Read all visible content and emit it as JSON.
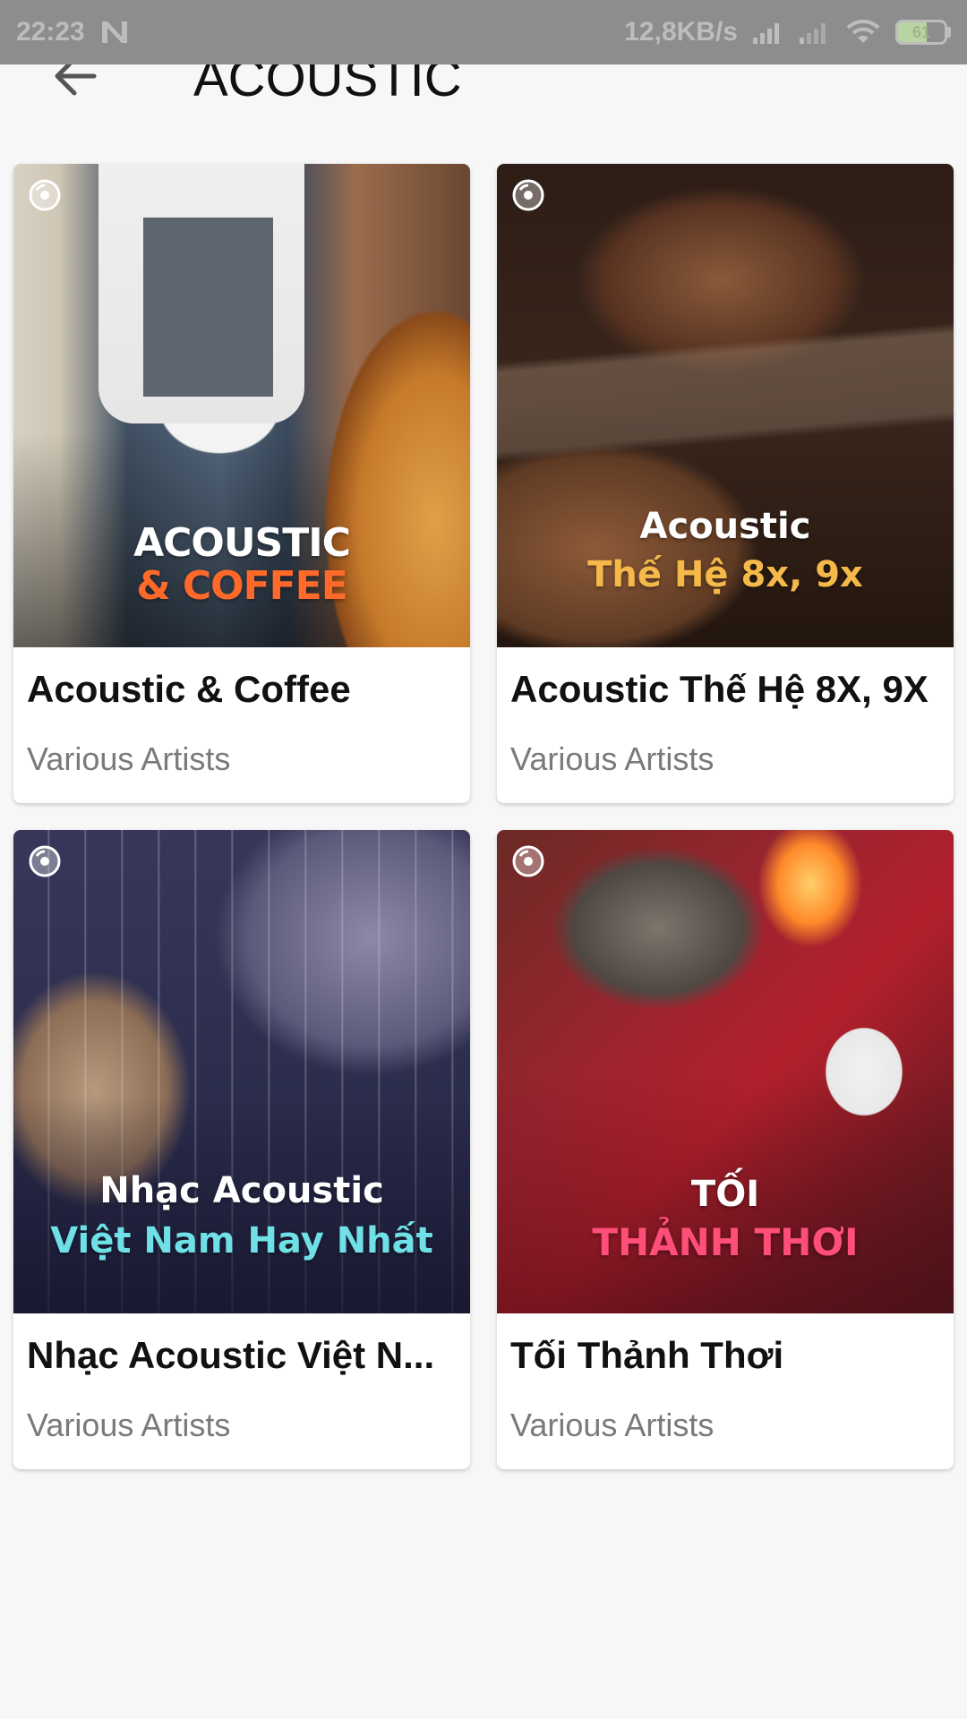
{
  "status_bar": {
    "time": "22:23",
    "network_speed": "12,8KB/s",
    "battery_level": "61",
    "battery_fraction": 0.61,
    "icons": [
      "n-notification-icon",
      "signal-icon",
      "signal-icon-2",
      "wifi-icon",
      "battery-icon"
    ]
  },
  "header": {
    "title": "ACOUSTIC",
    "back_icon": "arrow-left-icon"
  },
  "albums": [
    {
      "cover_line1": "ACOUSTIC",
      "cover_line2": "& COFFEE",
      "title": "Acoustic & Coffee",
      "artist": "Various Artists"
    },
    {
      "cover_line1": "Acoustic",
      "cover_line2": "Thế Hệ 8x, 9x",
      "title": "Acoustic Thế Hệ 8X, 9X",
      "artist": "Various Artists"
    },
    {
      "cover_line1": "Nhạc Acoustic",
      "cover_line2": "Việt Nam Hay Nhất",
      "title": "Nhạc Acoustic Việt N...",
      "artist": "Various Artists"
    },
    {
      "cover_line1": "TỐI",
      "cover_line2": "THẢNH THƠI",
      "title": "Tối Thảnh Thơi",
      "artist": "Various Artists"
    }
  ],
  "colors": {
    "status_bar_bg": "#8d8d8d",
    "page_bg": "#f7f7f7",
    "title_text": "#111111",
    "subtitle_text": "#7a7a7a"
  }
}
